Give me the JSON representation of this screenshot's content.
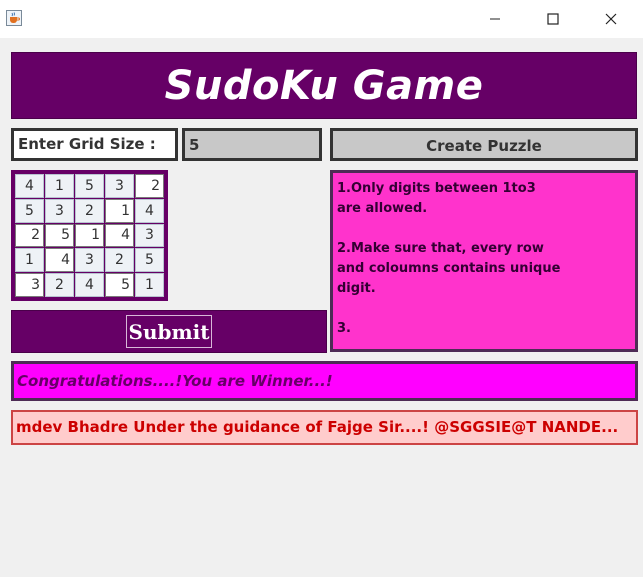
{
  "window": {
    "icon": "java-cup-icon",
    "controls": [
      "minimize-icon",
      "maximize-icon",
      "close-icon"
    ]
  },
  "header": {
    "title": "SudoKu Game"
  },
  "controls": {
    "grid_size_label": "Enter Grid Size :",
    "grid_size_value": "5",
    "create_button": "Create Puzzle"
  },
  "grid": {
    "size": 5,
    "cells": [
      [
        "4",
        "1",
        "5",
        "3",
        "2"
      ],
      [
        "5",
        "3",
        "2",
        "1",
        "4"
      ],
      [
        "2",
        "5",
        "1",
        "4",
        "3"
      ],
      [
        "1",
        "4",
        "3",
        "2",
        "5"
      ],
      [
        "3",
        "2",
        "4",
        "5",
        "1"
      ]
    ],
    "editable": [
      [
        false,
        false,
        false,
        false,
        true
      ],
      [
        false,
        false,
        false,
        true,
        false
      ],
      [
        true,
        true,
        true,
        true,
        false
      ],
      [
        false,
        true,
        false,
        false,
        false
      ],
      [
        true,
        false,
        false,
        true,
        false
      ]
    ]
  },
  "rules_text": "1.Only digits between 1to3\nare allowed.\n\n2.Make sure that, every row\nand coloumns contains unique\ndigit.\n\n3.",
  "submit_label": "Submit",
  "status_message": "Congratulations....!You are Winner...!",
  "footer_text": "mdev Bhadre Under the guidance of Fajge Sir....! @SGGSIE@T NANDE...",
  "colors": {
    "purple": "#660066",
    "rules_bg": "#ff33cc",
    "status_bg": "#ff00ff",
    "footer_bg": "#ffcccc",
    "footer_text": "#cc0000"
  }
}
